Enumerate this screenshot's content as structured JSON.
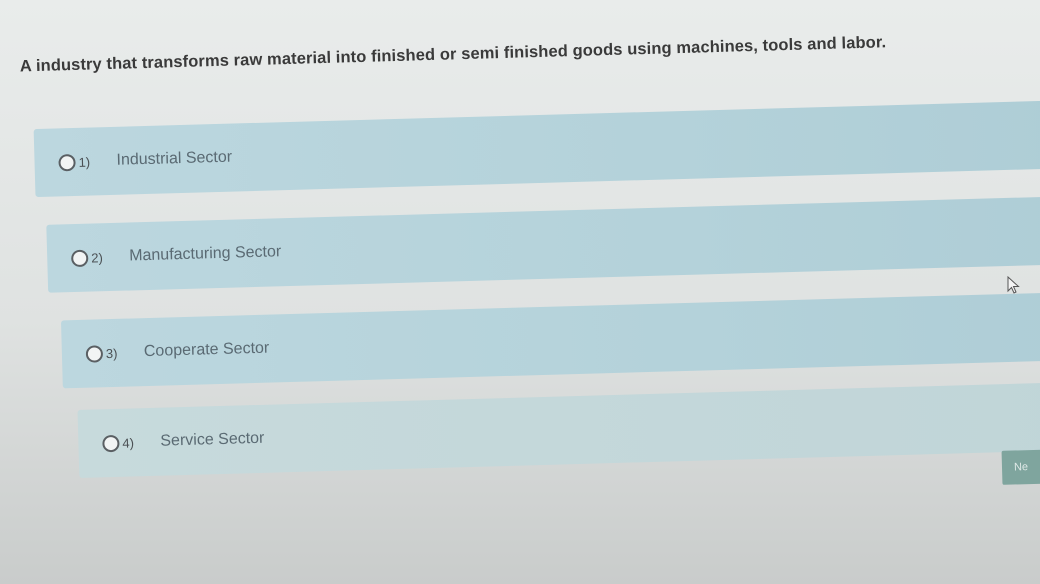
{
  "question": {
    "text": "A industry that transforms raw material into finished or semi finished goods using machines, tools and labor."
  },
  "options": [
    {
      "number": "1)",
      "label": "Industrial Sector"
    },
    {
      "number": "2)",
      "label": "Manufacturing Sector"
    },
    {
      "number": "3)",
      "label": "Cooperate Sector"
    },
    {
      "number": "4)",
      "label": "Service Sector"
    }
  ],
  "next_button": {
    "label": "Ne"
  },
  "colors": {
    "option_bg": "#b4d2da",
    "button_bg": "#7fa59e"
  }
}
